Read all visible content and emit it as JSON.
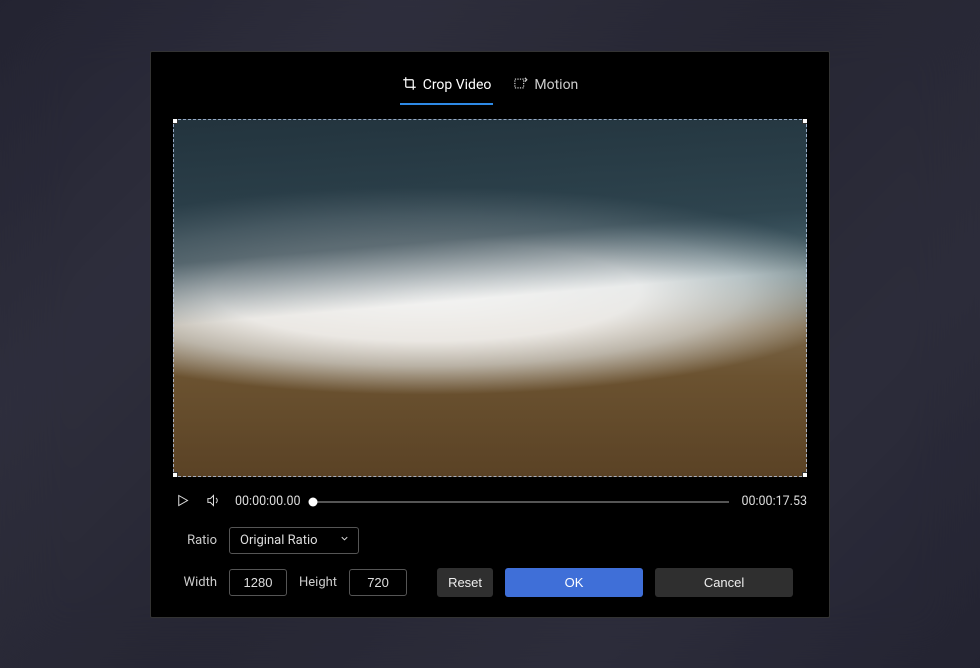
{
  "tabs": {
    "crop": "Crop Video",
    "motion": "Motion"
  },
  "playback": {
    "current": "00:00:00.00",
    "duration": "00:00:17.53"
  },
  "ratio": {
    "label": "Ratio",
    "selected": "Original Ratio"
  },
  "dimensions": {
    "width_label": "Width",
    "width_value": "1280",
    "height_label": "Height",
    "height_value": "720"
  },
  "buttons": {
    "reset": "Reset",
    "ok": "OK",
    "cancel": "Cancel"
  }
}
